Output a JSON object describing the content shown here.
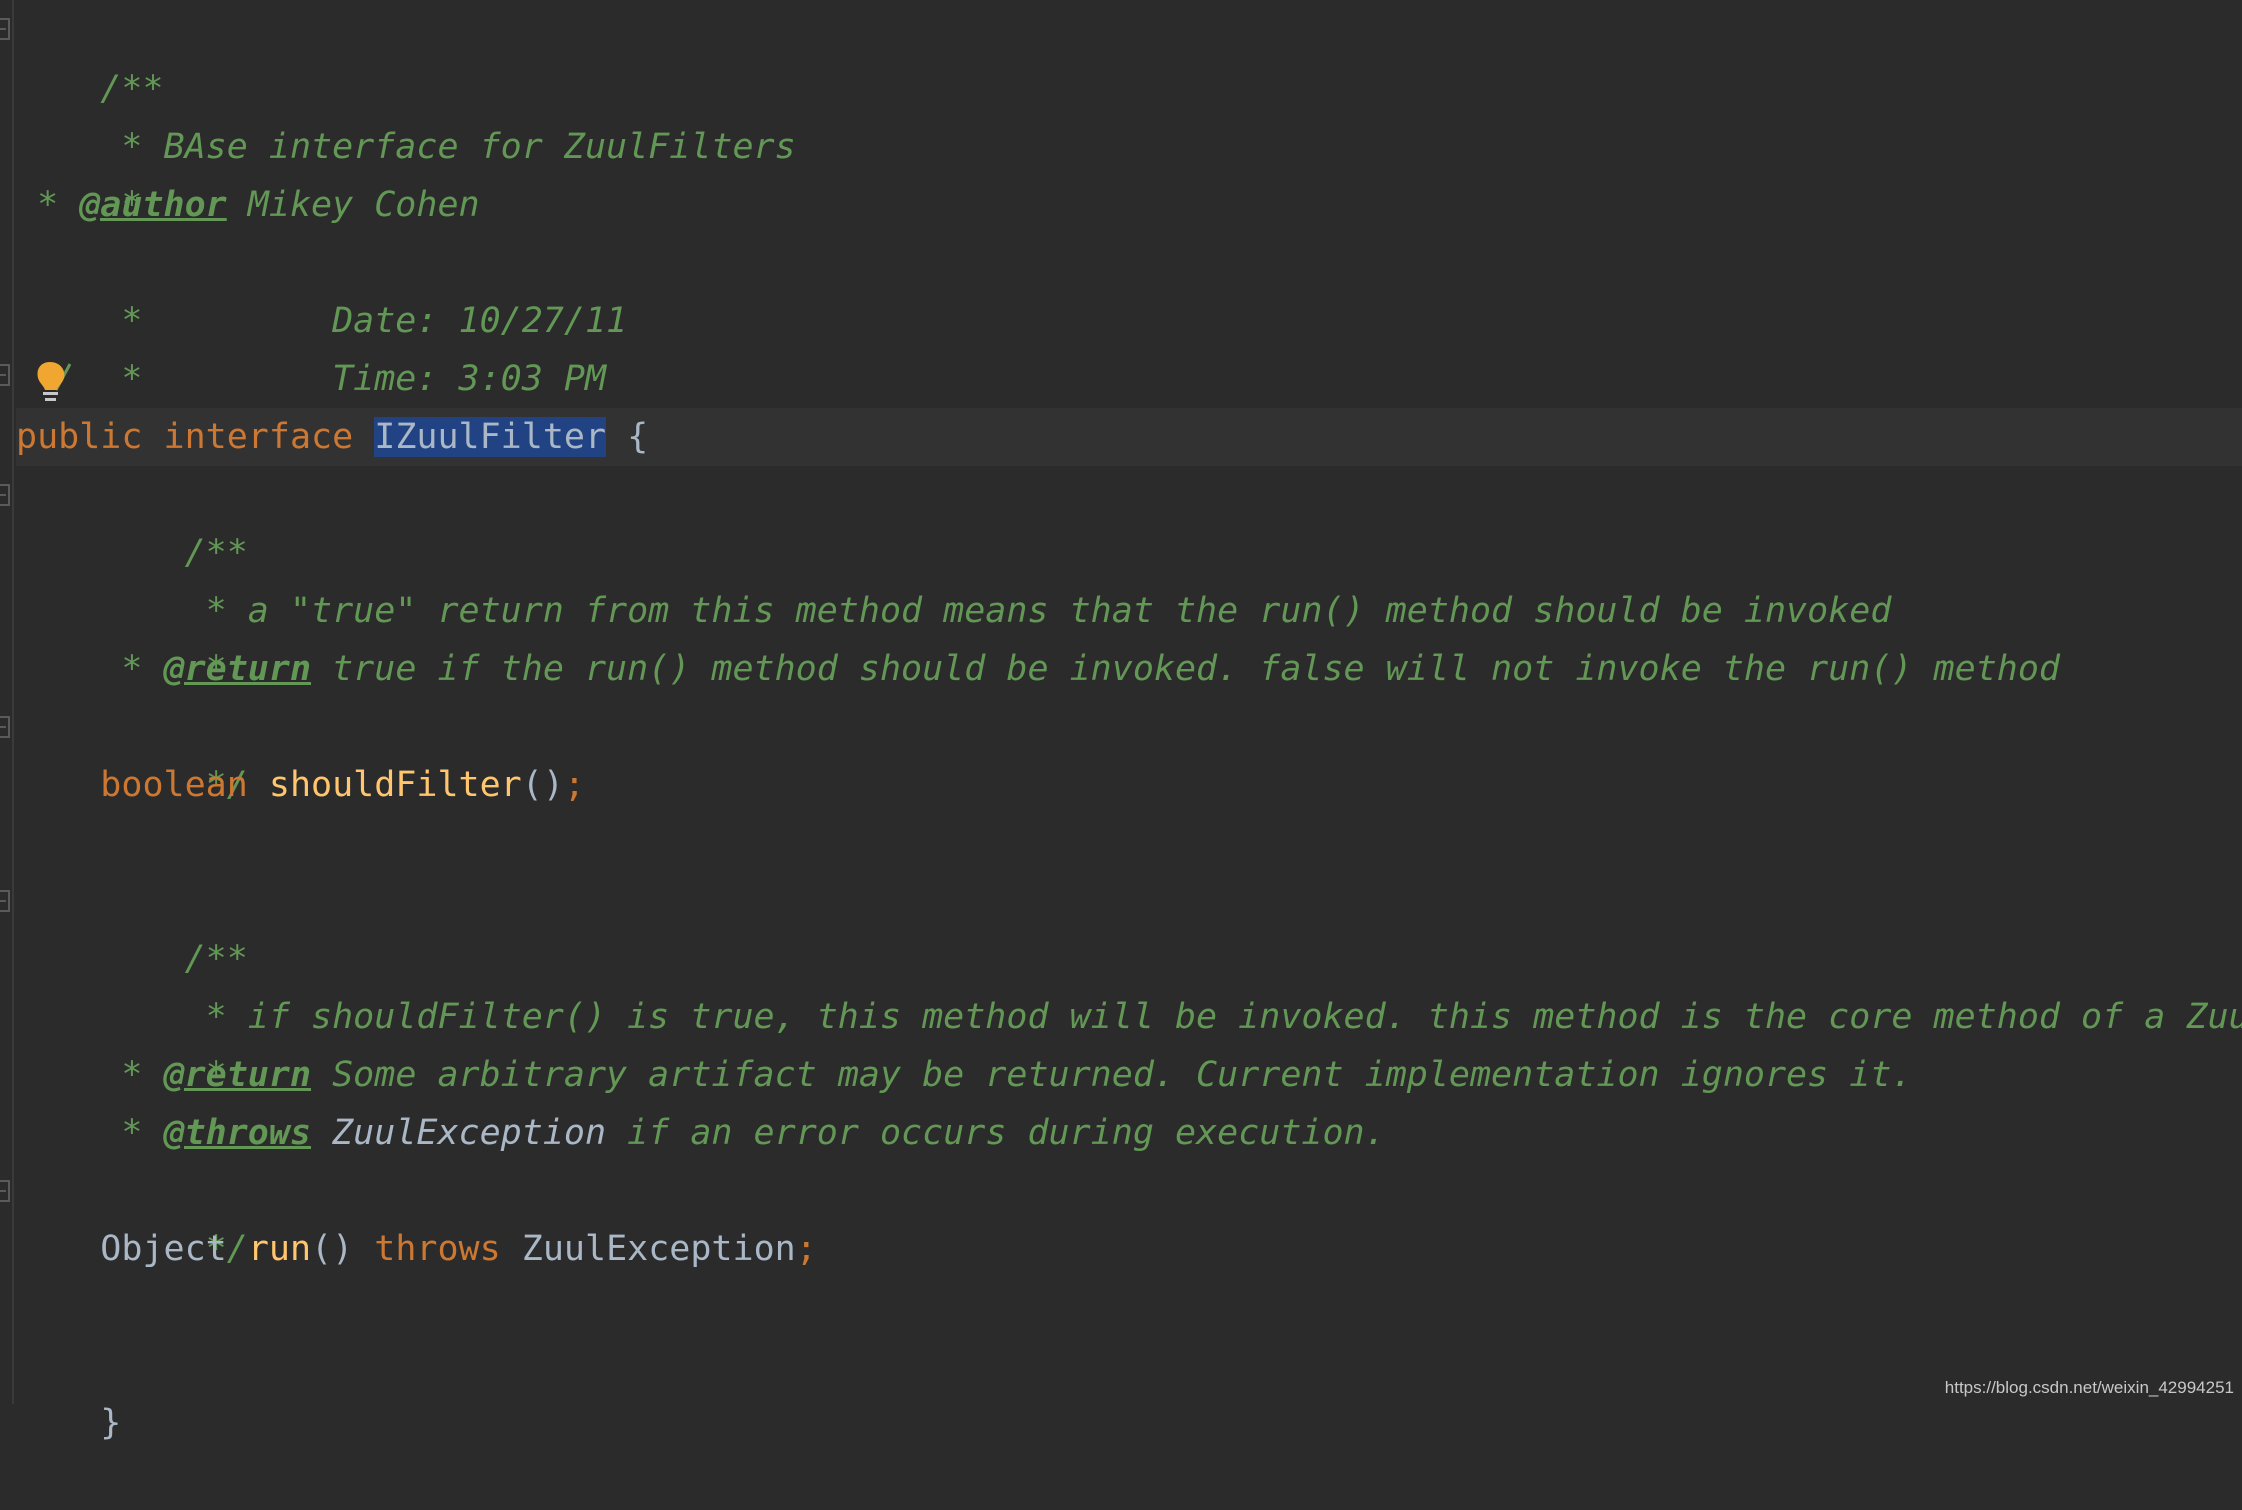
{
  "editor": {
    "colors": {
      "background": "#2b2b2b",
      "comment": "#629755",
      "keyword": "#cc7832",
      "method": "#ffc66d",
      "identifier": "#a9b7c6",
      "selection": "#214283"
    },
    "class_doc": {
      "open": "/**",
      "line1": " * BAse interface for ZuulFilters",
      "line2": " *",
      "author_prefix": " * ",
      "author_tag": "@author",
      "author_value": " Mikey Cohen",
      "date_line": " *         Date: 10/27/11",
      "time_line": " *         Time: 3:03 PM",
      "close": " */"
    },
    "declaration": {
      "public": "public",
      "interface": "interface",
      "name": "IZuulFilter",
      "brace_open": "{"
    },
    "should_filter_doc": {
      "open": "    /**",
      "line1": "     * a \"true\" return from this method means that the run() method should be invoked",
      "line2": "     *",
      "return_prefix": "     * ",
      "return_tag": "@return",
      "return_text": " true if the run() method should be invoked. false will not invoke the run() method",
      "close": "     */"
    },
    "should_filter_method": {
      "indent": "    ",
      "type": "boolean",
      "name": "shouldFilter",
      "parens": "()",
      "semicolon": ";"
    },
    "run_doc": {
      "open": "    /**",
      "line1": "     * if shouldFilter() is true, this method will be invoked. this method is the core method of a ZuulFilter",
      "line2": "     *",
      "return_prefix": "     * ",
      "return_tag": "@return",
      "return_text": " Some arbitrary artifact may be returned. Current implementation ignores it.",
      "throws_prefix": "     * ",
      "throws_tag": "@throws",
      "throws_ref": " ZuulException",
      "throws_text": " if an error occurs during execution.",
      "close": "     */"
    },
    "run_method": {
      "indent": "    ",
      "type": "Object",
      "name": "run",
      "parens": "()",
      "throws": "throws",
      "exception": "ZuulException",
      "semicolon": ";"
    },
    "brace_close": "}"
  },
  "icons": {
    "intention_bulb": "lightbulb-icon"
  },
  "watermark": "https://blog.csdn.net/weixin_42994251"
}
